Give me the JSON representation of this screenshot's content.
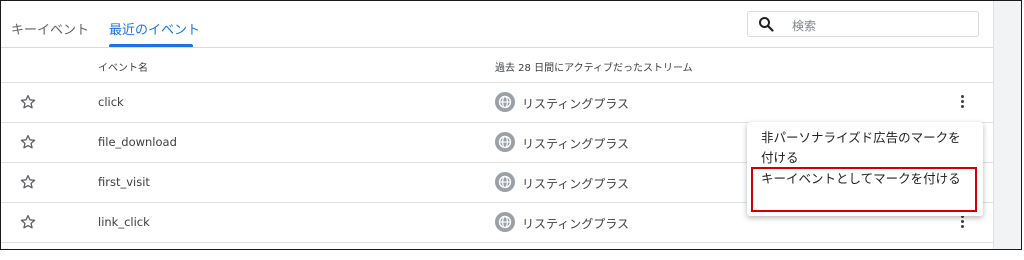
{
  "tabs": [
    {
      "label": "キーイベント"
    },
    {
      "label": "最近のイベント"
    }
  ],
  "search": {
    "placeholder": "検索"
  },
  "table": {
    "headers": {
      "event_name": "イベント名",
      "stream": "過去 28 日間にアクティブだったストリーム"
    },
    "rows": [
      {
        "name": "click",
        "stream": "リスティングプラス"
      },
      {
        "name": "file_download",
        "stream": "リスティングプラス"
      },
      {
        "name": "first_visit",
        "stream": "リスティングプラス"
      },
      {
        "name": "link_click",
        "stream": "リスティングプラス"
      }
    ]
  },
  "context_menu": {
    "items": [
      {
        "label": "非パーソナライズド広告のマークを付ける"
      },
      {
        "label": "キーイベントとしてマークを付ける"
      }
    ]
  },
  "colors": {
    "accent": "#1a73e8",
    "highlight": "#d40000"
  }
}
